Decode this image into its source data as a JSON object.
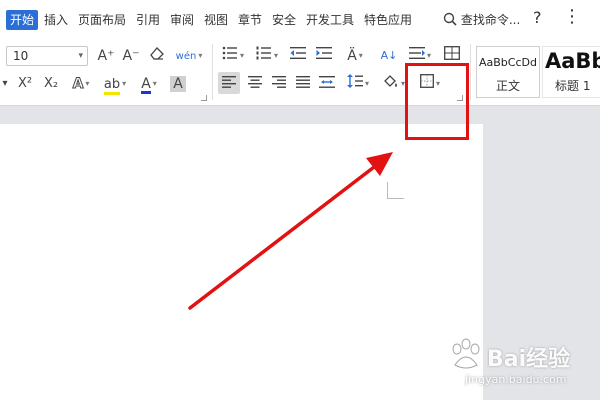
{
  "menu": {
    "tabs": [
      "开始",
      "插入",
      "页面布局",
      "引用",
      "审阅",
      "视图",
      "章节",
      "安全",
      "开发工具",
      "特色应用"
    ],
    "search_label": "查找命令...",
    "help_label": "?",
    "more_label": "⋮"
  },
  "ribbon": {
    "font_size_value": "10",
    "font_size_caret": "▾",
    "grow_font": "A⁺",
    "shrink_font": "A⁻",
    "clear_format": "◇",
    "phonetic": "wén",
    "superscript": "X²",
    "subscript": "X₂",
    "text_effect": "A",
    "highlight": "ab",
    "font_color": "A",
    "char_shading": "A",
    "sort": "A↓",
    "border_caret": "▾"
  },
  "styles": [
    {
      "sample": "AaBbCcDd",
      "name": "正文"
    },
    {
      "sample": "AaBb",
      "name": "标题 1"
    }
  ],
  "watermark": {
    "brand": "Bai经验",
    "url": "jingyan.baidu.com"
  },
  "colors": {
    "accent": "#2b6fd6",
    "annotation": "#e21212",
    "highlight_yellow": "#f5e400",
    "font_red": "#e02020",
    "font_blue": "#1a36d6"
  }
}
